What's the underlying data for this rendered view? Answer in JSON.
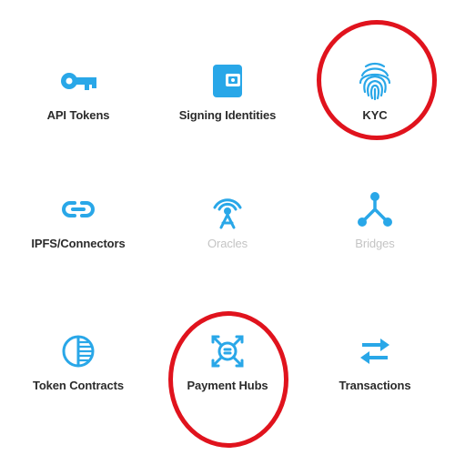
{
  "colors": {
    "accent": "#29a7e8",
    "disabled": "#c4c4c4",
    "label": "#2b2b2b",
    "highlight_ring": "#e0131d"
  },
  "tiles": [
    {
      "label": "API Tokens",
      "icon": "key-icon",
      "enabled": true
    },
    {
      "label": "Signing Identities",
      "icon": "wallet-icon",
      "enabled": true
    },
    {
      "label": "KYC",
      "icon": "fingerprint-icon",
      "enabled": true,
      "highlighted": true
    },
    {
      "label": "IPFS/Connectors",
      "icon": "link-icon",
      "enabled": true
    },
    {
      "label": "Oracles",
      "icon": "broadcast-tower-icon",
      "enabled": false
    },
    {
      "label": "Bridges",
      "icon": "network-fork-icon",
      "enabled": false
    },
    {
      "label": "Token Contracts",
      "icon": "contract-circle-icon",
      "enabled": true
    },
    {
      "label": "Payment Hubs",
      "icon": "payment-hub-icon",
      "enabled": true,
      "highlighted": true
    },
    {
      "label": "Transactions",
      "icon": "swap-arrows-icon",
      "enabled": true
    }
  ]
}
